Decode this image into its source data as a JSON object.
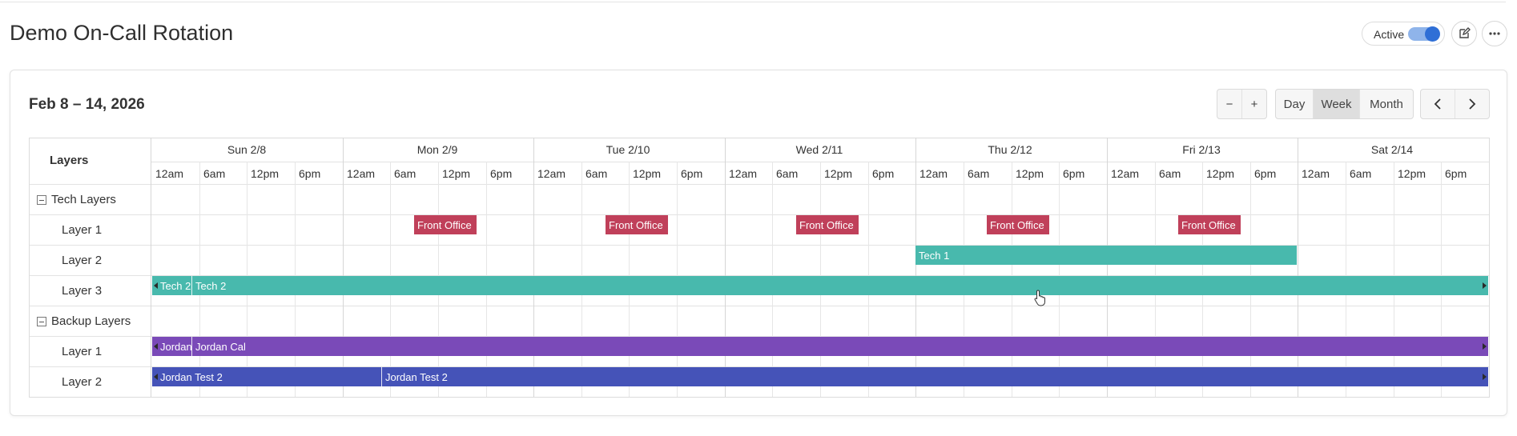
{
  "page": {
    "title": "Demo On-Call Rotation",
    "active_label": "Active",
    "active_on": true
  },
  "calendar": {
    "range_label": "Feb 8 – 14, 2026",
    "zoom_out_label": "−",
    "zoom_in_label": "+",
    "views": [
      {
        "label": "Day",
        "selected": false
      },
      {
        "label": "Week",
        "selected": true
      },
      {
        "label": "Month",
        "selected": false
      }
    ]
  },
  "grid": {
    "layers_header": "Layers",
    "days": [
      "Sun 2/8",
      "Mon 2/9",
      "Tue 2/10",
      "Wed 2/11",
      "Thu 2/12",
      "Fri 2/13",
      "Sat 2/14"
    ],
    "times": [
      "12am",
      "6am",
      "12pm",
      "6pm"
    ],
    "rows": [
      {
        "kind": "group",
        "label": "Tech Layers"
      },
      {
        "kind": "layer",
        "label": "Layer 1"
      },
      {
        "kind": "layer",
        "label": "Layer 2"
      },
      {
        "kind": "layer",
        "label": "Layer 3"
      },
      {
        "kind": "group",
        "label": "Backup Layers"
      },
      {
        "kind": "layer",
        "label": "Layer 1"
      },
      {
        "kind": "layer",
        "label": "Layer 2"
      }
    ]
  },
  "events": {
    "front_office_label": "Front Office",
    "tech1_label": "Tech 1",
    "tech2_a": "Tech 2",
    "tech2_b": "Tech 2",
    "jordan_a": "Jordan Cal",
    "jordan_b": "Jordan Cal",
    "jordan_test_a": "Jordan Test 2",
    "jordan_test_b": "Jordan Test 2"
  },
  "colors": {
    "front_office": "#c0405a",
    "tech": "#48b9ad",
    "jordan_cal": "#7a4ab8",
    "jordan_test": "#4553b8"
  }
}
